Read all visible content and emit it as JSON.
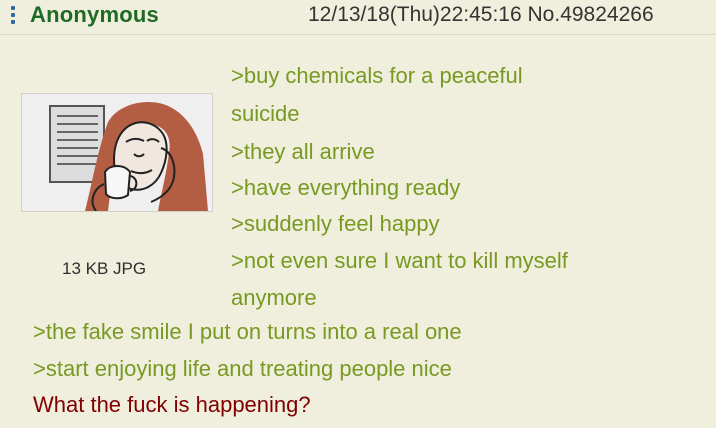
{
  "post": {
    "name": "Anonymous",
    "datetime": "12/13/18(Thu)22:45:16",
    "number": "No.49824266",
    "file_info": "13 KB JPG",
    "greentext": [
      ">buy chemicals for a peaceful",
      "suicide",
      ">they all arrive",
      ">have everything ready",
      ">suddenly feel happy",
      ">not even sure I want to kill myself",
      "anymore",
      ">the fake smile I put on turns into a real one",
      ">start enjoying life and treating people nice"
    ],
    "final_line": "What the fuck is happening?",
    "colors": {
      "greentext": "#789922",
      "name": "#1f6a24",
      "final_line": "#800000",
      "background": "#f0efdd"
    },
    "icons": {
      "post_menu": "post-menu-icon",
      "thumbnail": "thumbnail-image"
    }
  }
}
